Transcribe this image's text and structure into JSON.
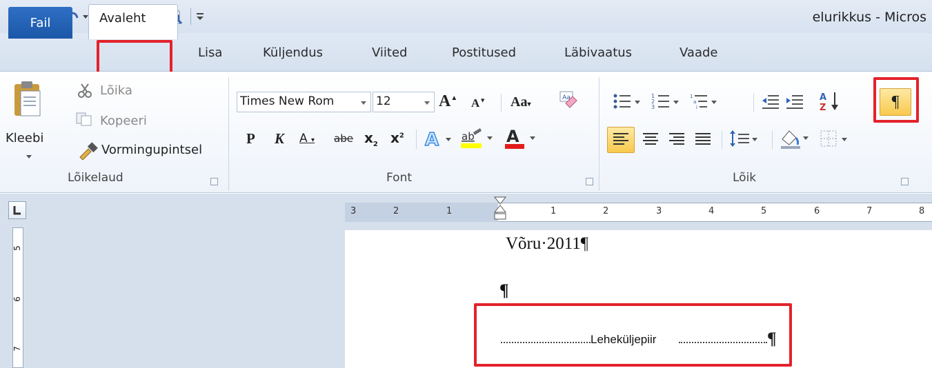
{
  "window": {
    "title": "elurikkus - Micros"
  },
  "tabs": {
    "file": "Fail",
    "home": "Avaleht",
    "insert": "Lisa",
    "layout": "Küljendus",
    "references": "Viited",
    "mailings": "Postitused",
    "review": "Läbivaatus",
    "view": "Vaade"
  },
  "clipboard": {
    "cut": "Lõika",
    "copy": "Kopeeri",
    "paste": "Kleebi",
    "format_painter": "Vormingupintsel",
    "group_label": "Lõikelaud"
  },
  "font": {
    "font_name": "Times New Rom",
    "font_size": "12",
    "group_label": "Font",
    "bold": "P",
    "italic": "K",
    "underline": "A",
    "strike": "abe",
    "subscript": "x",
    "superscript": "x",
    "change_case": "Aa",
    "font_color": "A",
    "highlight": "ab",
    "grow": "A",
    "shrink": "A"
  },
  "paragraph": {
    "group_label": "Lõik",
    "show_marks": "¶",
    "sort": "A Z"
  },
  "ruler": {
    "h_labels": [
      "3",
      "2",
      "1",
      "1",
      "2",
      "3",
      "4",
      "5",
      "6",
      "7",
      "8"
    ],
    "v_labels": [
      "5",
      "6",
      "7"
    ]
  },
  "document": {
    "line1": "Võru·2011¶",
    "line2": "¶",
    "page_break": "Leheküljepiir",
    "pilcrow": "¶"
  },
  "colors": {
    "accent": "#1b57a8",
    "highlight_red": "#e3222b",
    "active_button": "#fbd66a"
  }
}
